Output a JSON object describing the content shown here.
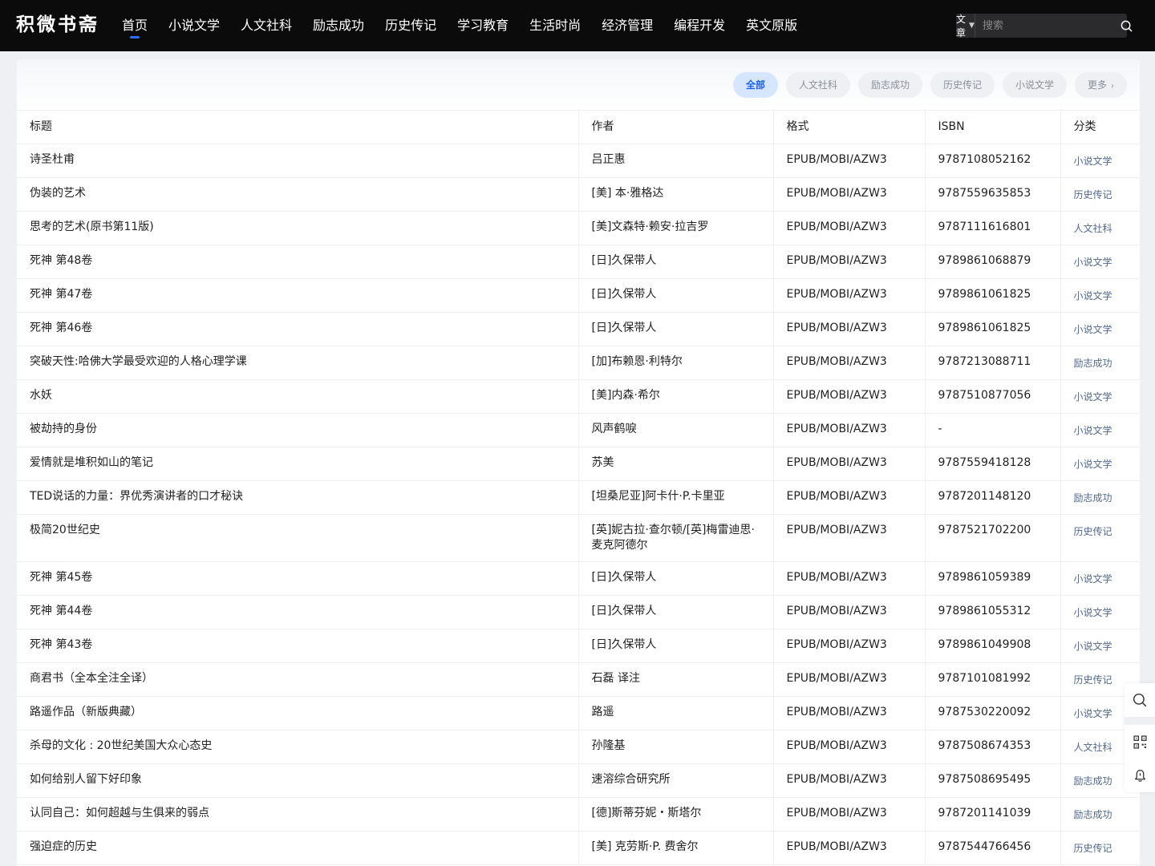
{
  "header": {
    "logo": "积微书斋",
    "nav": [
      "首页",
      "小说文学",
      "人文社科",
      "励志成功",
      "历史传记",
      "学习教育",
      "生活时尚",
      "经济管理",
      "编程开发",
      "英文原版"
    ],
    "active_nav_index": 0,
    "search": {
      "type_label": "文章",
      "placeholder": "搜索"
    }
  },
  "filters": {
    "chips": [
      "全部",
      "人文社科",
      "励志成功",
      "历史传记",
      "小说文学"
    ],
    "active_index": 0,
    "more_label": "更多"
  },
  "table": {
    "columns": [
      "标题",
      "作者",
      "格式",
      "ISBN",
      "分类"
    ],
    "rows": [
      [
        "诗圣杜甫",
        "吕正惠",
        "EPUB/MOBI/AZW3",
        "9787108052162",
        "小说文学"
      ],
      [
        "伪装的艺术",
        "[美] 本·雅格达",
        "EPUB/MOBI/AZW3",
        "9787559635853",
        "历史传记"
      ],
      [
        "思考的艺术(原书第11版)",
        "[美]文森特·赖安·拉吉罗",
        "EPUB/MOBI/AZW3",
        "9787111616801",
        "人文社科"
      ],
      [
        "死神 第48卷",
        "[日]久保带人",
        "EPUB/MOBI/AZW3",
        "9789861068879",
        "小说文学"
      ],
      [
        "死神 第47卷",
        "[日]久保带人",
        "EPUB/MOBI/AZW3",
        "9789861061825",
        "小说文学"
      ],
      [
        "死神 第46卷",
        "[日]久保带人",
        "EPUB/MOBI/AZW3",
        "9789861061825",
        "小说文学"
      ],
      [
        "突破天性:哈佛大学最受欢迎的人格心理学课",
        "[加]布赖恩·利特尔",
        "EPUB/MOBI/AZW3",
        "9787213088711",
        "励志成功"
      ],
      [
        "水妖",
        "[美]内森·希尔",
        "EPUB/MOBI/AZW3",
        "9787510877056",
        "小说文学"
      ],
      [
        "被劫持的身份",
        "风声鹤唳",
        "EPUB/MOBI/AZW3",
        "-",
        "小说文学"
      ],
      [
        "爱情就是堆积如山的笔记",
        "苏美",
        "EPUB/MOBI/AZW3",
        "9787559418128",
        "小说文学"
      ],
      [
        "TED说话的力量：界优秀演讲者的口才秘诀",
        "[坦桑尼亚]阿卡什·P.卡里亚",
        "EPUB/MOBI/AZW3",
        "9787201148120",
        "励志成功"
      ],
      [
        "极简20世纪史",
        "[英]妮古拉·查尔顿/[英]梅雷迪思·麦克阿德尔",
        "EPUB/MOBI/AZW3",
        "9787521702200",
        "历史传记"
      ],
      [
        "死神 第45卷",
        "[日]久保带人",
        "EPUB/MOBI/AZW3",
        "9789861059389",
        "小说文学"
      ],
      [
        "死神 第44卷",
        "[日]久保带人",
        "EPUB/MOBI/AZW3",
        "9789861055312",
        "小说文学"
      ],
      [
        "死神 第43卷",
        "[日]久保带人",
        "EPUB/MOBI/AZW3",
        "9789861049908",
        "小说文学"
      ],
      [
        "商君书（全本全注全译）",
        "石磊 译注",
        "EPUB/MOBI/AZW3",
        "9787101081992",
        "历史传记"
      ],
      [
        "路遥作品（新版典藏）",
        "路遥",
        "EPUB/MOBI/AZW3",
        "9787530220092",
        "小说文学"
      ],
      [
        "杀母的文化 : 20世纪美国大众心态史",
        "孙隆基",
        "EPUB/MOBI/AZW3",
        "9787508674353",
        "人文社科"
      ],
      [
        "如何给别人留下好印象",
        "速溶综合研究所",
        "EPUB/MOBI/AZW3",
        "9787508695495",
        "励志成功"
      ],
      [
        "认同自己：如何超越与生俱来的弱点",
        "[德]斯蒂芬妮・斯塔尔",
        "EPUB/MOBI/AZW3",
        "9787201141039",
        "励志成功"
      ],
      [
        "强迫症的历史",
        "[美] 克劳斯·P. 费舍尔",
        "EPUB/MOBI/AZW3",
        "9787544766456",
        "历史传记"
      ]
    ]
  },
  "side_tools": [
    "search-icon",
    "qrcode-icon",
    "bell-icon"
  ],
  "colors": {
    "header_bg": "#0b0b0c",
    "accent": "#2d6ff5",
    "category_text": "#52688e",
    "chip_active_bg": "#d7e6ff"
  }
}
